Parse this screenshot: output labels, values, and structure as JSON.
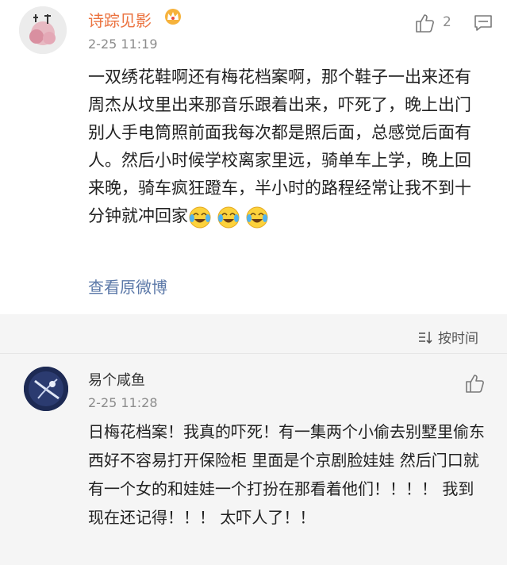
{
  "comment": {
    "user_name": "诗踪见影",
    "timestamp": "2-25 11:19",
    "like_count": "2",
    "body": "一双绣花鞋啊还有梅花档案啊，那个鞋子一出来还有周杰从坟里出来那音乐跟着出来，吓死了，晚上出门别人手电筒照前面我每次都是照后面，总感觉后面有人。然后小时候学校离家里远，骑单车上学，晚上回来晚，骑车疯狂蹬车，半小时的路程经常让我不到十分钟就冲回家",
    "view_original": "查看原微博",
    "icons": [
      "avatar",
      "crown-badge-icon",
      "like-icon",
      "reply-icon",
      "crying-laughing-emoji"
    ]
  },
  "sort": {
    "label": "按时间",
    "icon": "sort-icon"
  },
  "reply": {
    "user_name": "易个咸鱼",
    "timestamp": "2-25 11:28",
    "body": "日梅花档案！我真的吓死！有一集两个小偷去别墅里偷东西好不容易打开保险柜  里面是个京剧脸娃娃  然后门口就有一个女的和娃娃一个打扮在那看着他们！！！！ 我到现在还记得！！！ 太吓人了！！",
    "icons": [
      "avatar",
      "like-icon"
    ]
  },
  "colors": {
    "accent_name": "#eb7340",
    "link": "#5b78a8",
    "muted": "#8c8c8c",
    "gray_bg": "#f5f5f5"
  }
}
